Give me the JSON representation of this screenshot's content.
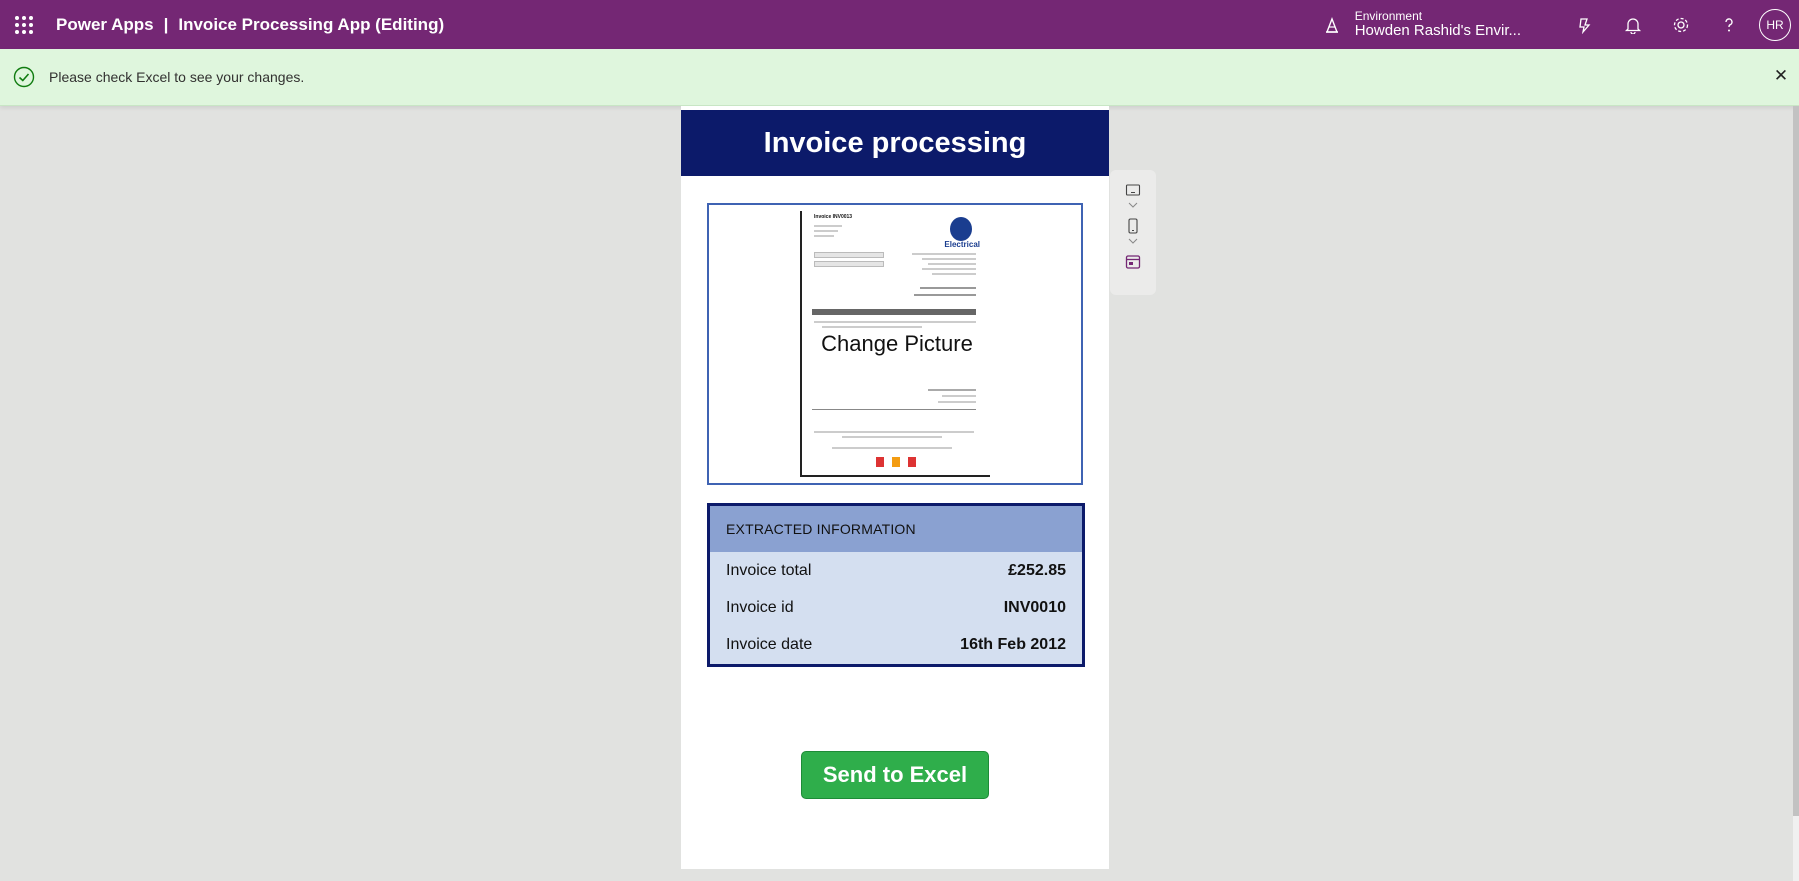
{
  "topbar": {
    "app_name": "Power Apps",
    "separator": "|",
    "app_title": "Invoice Processing App (Editing)",
    "environment_label": "Environment",
    "environment_value": "Howden Rashid's Envir...",
    "avatar_initials": "HR",
    "icons": [
      "waffle-icon",
      "environment-icon",
      "copilot-icon",
      "bell-icon",
      "gear-icon",
      "help-icon"
    ]
  },
  "notification": {
    "message": "Please check Excel to see your changes.",
    "close_glyph": "✕",
    "color": "#dff6dd"
  },
  "app": {
    "header_title": "Invoice processing",
    "change_picture_label": "Change Picture",
    "extracted": {
      "heading": "EXTRACTED INFORMATION",
      "rows": [
        {
          "label": "Invoice total",
          "value": "£252.85"
        },
        {
          "label": "Invoice id",
          "value": "INV0010"
        },
        {
          "label": "Invoice date",
          "value": "16th Feb 2012"
        }
      ]
    },
    "send_button_label": "Send to Excel"
  },
  "colors": {
    "topbar": "#742774",
    "header": "#0c1a6a",
    "send_button": "#2fae4b",
    "extracted_head": "#8aa1d1",
    "extracted_body": "#d4dff0"
  }
}
